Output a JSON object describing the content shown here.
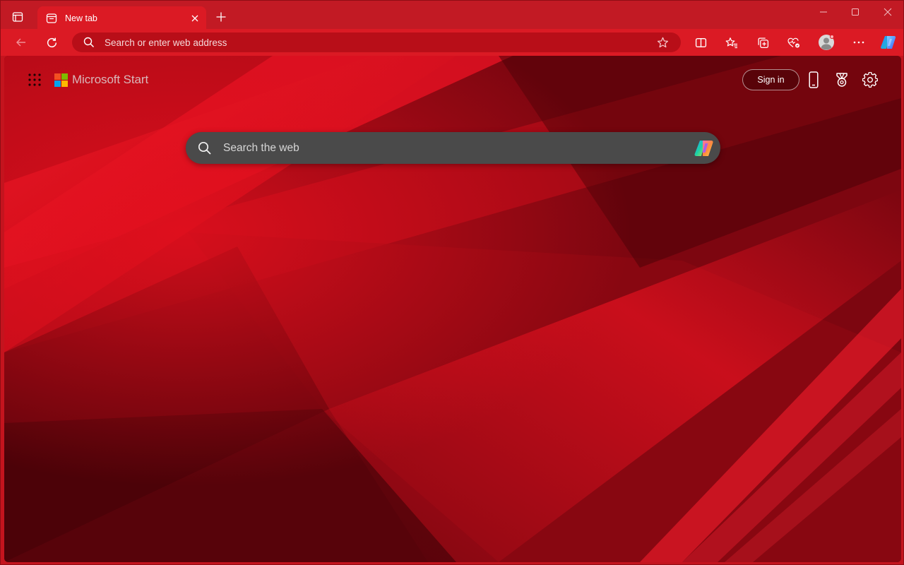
{
  "browser": {
    "tab": {
      "title": "New tab"
    },
    "address_bar": {
      "placeholder": "Search or enter web address"
    },
    "icons": {
      "tab_actions": "tab-actions-icon",
      "new_tab": "plus-icon",
      "back": "back-arrow-icon",
      "refresh": "refresh-icon",
      "favorite": "star-icon",
      "split_screen": "split-screen-icon",
      "favorites": "favorites-icon",
      "collections": "collections-icon",
      "browser_essentials": "heart-pulse-icon",
      "profile": "profile-icon",
      "more": "more-icon",
      "copilot": "copilot-icon"
    }
  },
  "page": {
    "brand_name": "Microsoft Start",
    "sign_in_label": "Sign in",
    "search_placeholder": "Search the web",
    "header_icons": [
      "phone-icon",
      "rewards-trophy-icon",
      "gear-icon"
    ]
  },
  "colors": {
    "titlebar": "#c21a24",
    "toolbar": "#db1a24",
    "address_bar": "#b80e18",
    "search_box": "#4a4a4a"
  }
}
